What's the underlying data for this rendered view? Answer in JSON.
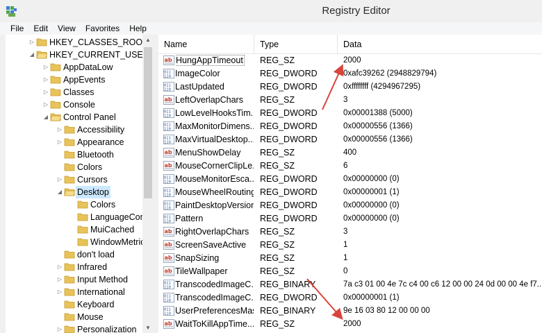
{
  "window": {
    "title": "Registry Editor"
  },
  "menu": [
    "File",
    "Edit",
    "View",
    "Favorites",
    "Help"
  ],
  "tree": [
    {
      "label": "HKEY_CLASSES_ROOT",
      "expanded": false,
      "level": 0
    },
    {
      "label": "HKEY_CURRENT_USER",
      "expanded": true,
      "level": 0
    },
    {
      "label": "AppDataLow",
      "expanded": false,
      "level": 1
    },
    {
      "label": "AppEvents",
      "expanded": false,
      "level": 1
    },
    {
      "label": "Classes",
      "expanded": false,
      "level": 1
    },
    {
      "label": "Console",
      "expanded": false,
      "level": 1
    },
    {
      "label": "Control Panel",
      "expanded": true,
      "level": 1
    },
    {
      "label": "Accessibility",
      "expanded": false,
      "level": 2
    },
    {
      "label": "Appearance",
      "expanded": false,
      "level": 2
    },
    {
      "label": "Bluetooth",
      "expanded": null,
      "level": 2
    },
    {
      "label": "Colors",
      "expanded": null,
      "level": 2
    },
    {
      "label": "Cursors",
      "expanded": false,
      "level": 2
    },
    {
      "label": "Desktop",
      "expanded": true,
      "level": 2,
      "selected": true
    },
    {
      "label": "Colors",
      "expanded": null,
      "level": 3
    },
    {
      "label": "LanguageConf",
      "expanded": null,
      "level": 3
    },
    {
      "label": "MuiCached",
      "expanded": null,
      "level": 3
    },
    {
      "label": "WindowMetric",
      "expanded": null,
      "level": 3
    },
    {
      "label": "don't load",
      "expanded": null,
      "level": 2
    },
    {
      "label": "Infrared",
      "expanded": false,
      "level": 2
    },
    {
      "label": "Input Method",
      "expanded": false,
      "level": 2
    },
    {
      "label": "International",
      "expanded": false,
      "level": 2
    },
    {
      "label": "Keyboard",
      "expanded": null,
      "level": 2
    },
    {
      "label": "Mouse",
      "expanded": null,
      "level": 2
    },
    {
      "label": "Personalization",
      "expanded": false,
      "level": 2
    }
  ],
  "columns": {
    "name": "Name",
    "type": "Type",
    "data": "Data"
  },
  "values": [
    {
      "name": "HungAppTimeout",
      "type": "REG_SZ",
      "data": "2000",
      "icon": "string-value-icon",
      "focused": true
    },
    {
      "name": "ImageColor",
      "type": "REG_DWORD",
      "data": "0xafc39262 (2948829794)",
      "icon": "binary-value-icon"
    },
    {
      "name": "LastUpdated",
      "type": "REG_DWORD",
      "data": "0xffffffff (4294967295)",
      "icon": "binary-value-icon"
    },
    {
      "name": "LeftOverlapChars",
      "type": "REG_SZ",
      "data": "3",
      "icon": "string-value-icon"
    },
    {
      "name": "LowLevelHooksTim...",
      "type": "REG_DWORD",
      "data": "0x00001388 (5000)",
      "icon": "binary-value-icon"
    },
    {
      "name": "MaxMonitorDimens...",
      "type": "REG_DWORD",
      "data": "0x00000556 (1366)",
      "icon": "binary-value-icon"
    },
    {
      "name": "MaxVirtualDesktop...",
      "type": "REG_DWORD",
      "data": "0x00000556 (1366)",
      "icon": "binary-value-icon"
    },
    {
      "name": "MenuShowDelay",
      "type": "REG_SZ",
      "data": "400",
      "icon": "string-value-icon"
    },
    {
      "name": "MouseCornerClipLe...",
      "type": "REG_SZ",
      "data": "6",
      "icon": "string-value-icon"
    },
    {
      "name": "MouseMonitorEsca...",
      "type": "REG_DWORD",
      "data": "0x00000000 (0)",
      "icon": "binary-value-icon"
    },
    {
      "name": "MouseWheelRouting",
      "type": "REG_DWORD",
      "data": "0x00000001 (1)",
      "icon": "binary-value-icon"
    },
    {
      "name": "PaintDesktopVersion",
      "type": "REG_DWORD",
      "data": "0x00000000 (0)",
      "icon": "binary-value-icon"
    },
    {
      "name": "Pattern",
      "type": "REG_DWORD",
      "data": "0x00000000 (0)",
      "icon": "binary-value-icon"
    },
    {
      "name": "RightOverlapChars",
      "type": "REG_SZ",
      "data": "3",
      "icon": "string-value-icon"
    },
    {
      "name": "ScreenSaveActive",
      "type": "REG_SZ",
      "data": "1",
      "icon": "string-value-icon"
    },
    {
      "name": "SnapSizing",
      "type": "REG_SZ",
      "data": "1",
      "icon": "string-value-icon"
    },
    {
      "name": "TileWallpaper",
      "type": "REG_SZ",
      "data": "0",
      "icon": "string-value-icon"
    },
    {
      "name": "TranscodedImageC...",
      "type": "REG_BINARY",
      "data": "7a c3 01 00 4e 7c c4 00 c6 12 00 00 24 0d 00 00 4e f7...",
      "icon": "binary-value-icon"
    },
    {
      "name": "TranscodedImageC...",
      "type": "REG_DWORD",
      "data": "0x00000001 (1)",
      "icon": "binary-value-icon"
    },
    {
      "name": "UserPreferencesMask",
      "type": "REG_BINARY",
      "data": "9e 16 03 80 12 00 00 00",
      "icon": "binary-value-icon"
    },
    {
      "name": "WaitToKillAppTime...",
      "type": "REG_SZ",
      "data": "2000",
      "icon": "string-value-icon"
    }
  ],
  "colors": {
    "annotation_arrow": "#d9453a",
    "folder": "#e8c35a",
    "selection": "#cce8ff",
    "string_icon": "#c0392b",
    "binary_icon": "#2f5aa8"
  }
}
